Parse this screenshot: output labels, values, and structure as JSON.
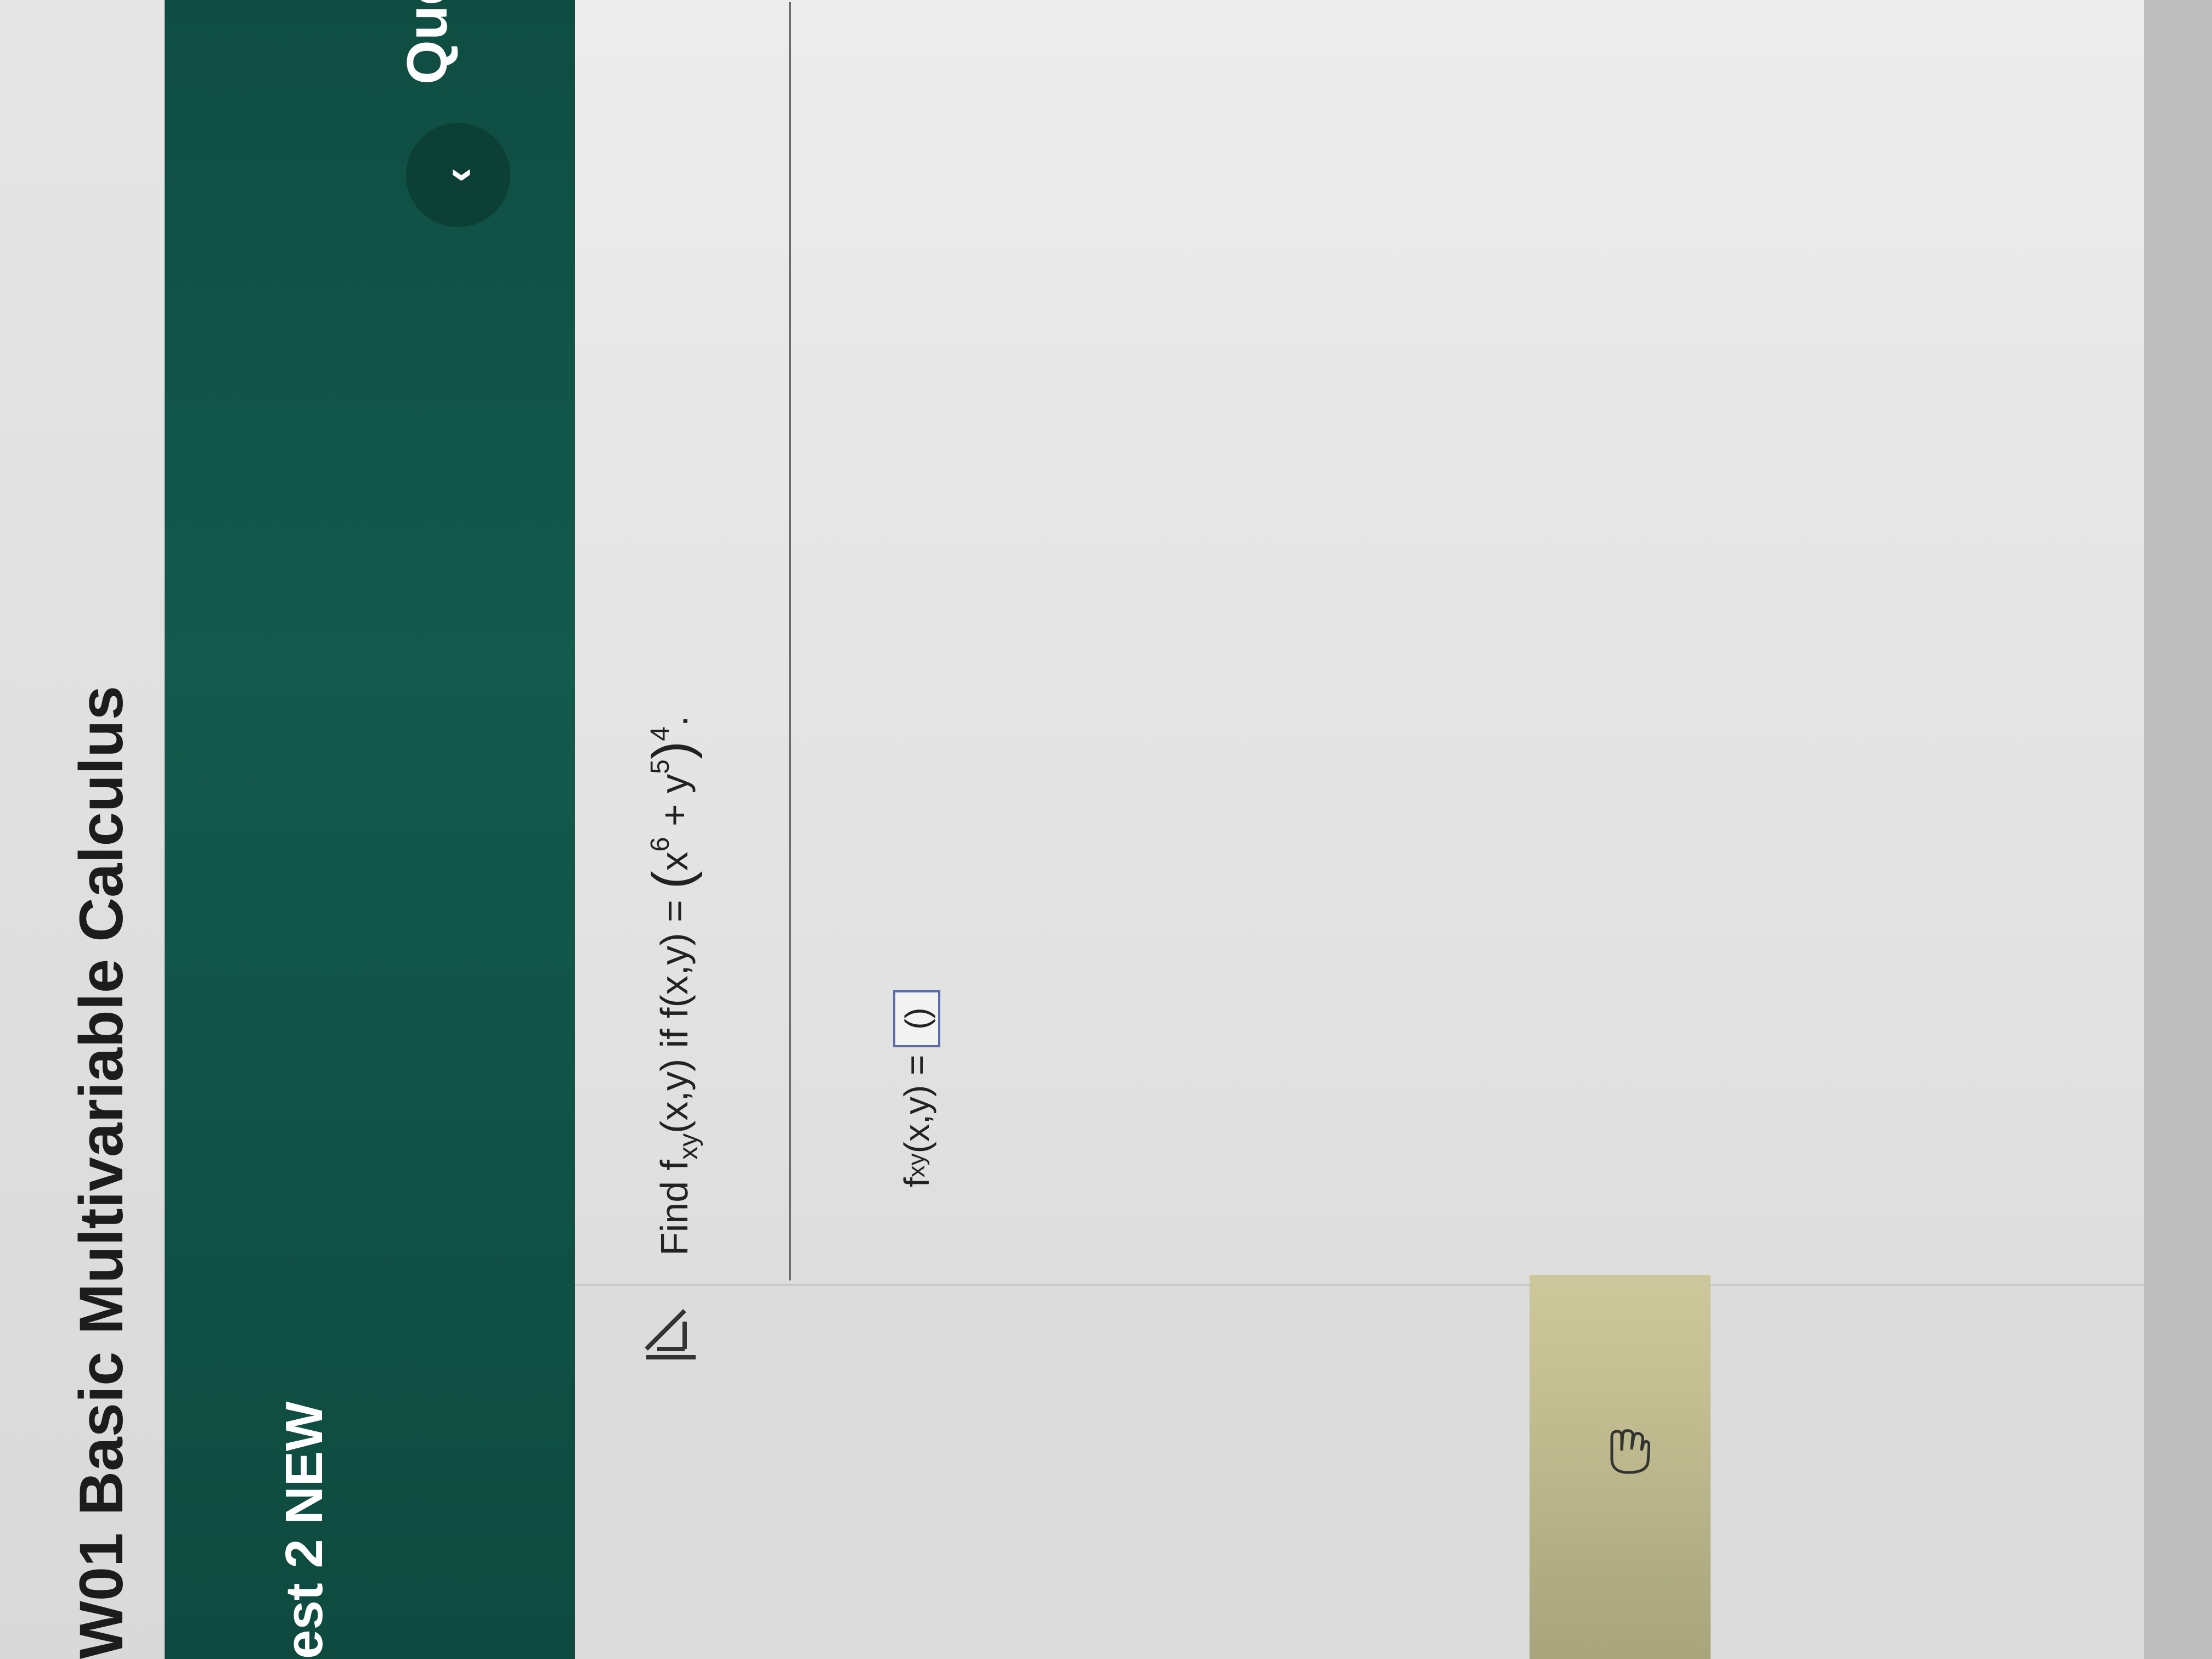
{
  "course": {
    "title": "W01 Basic Multivariable Calculus"
  },
  "header": {
    "test_title": "est 2 NEW",
    "question_label": "Quest",
    "prev_glyph": "‹"
  },
  "question": {
    "prefix": "Find f",
    "sub1": "xy",
    "mid": "(x,y) if f(x,y) = ",
    "open_paren": "(",
    "x_base": "x",
    "x_exp": "6",
    "plus": " + y",
    "y_exp": "5",
    "close_paren": ")",
    "outer_exp": "4",
    "end": "."
  },
  "answer": {
    "label_f": "f",
    "label_sub": "xy",
    "label_rest": "(x,y) = ",
    "input_value": "()"
  },
  "icons": [
    "collapse-icon",
    "hand-pointer-icon",
    "chevron-left-icon"
  ]
}
